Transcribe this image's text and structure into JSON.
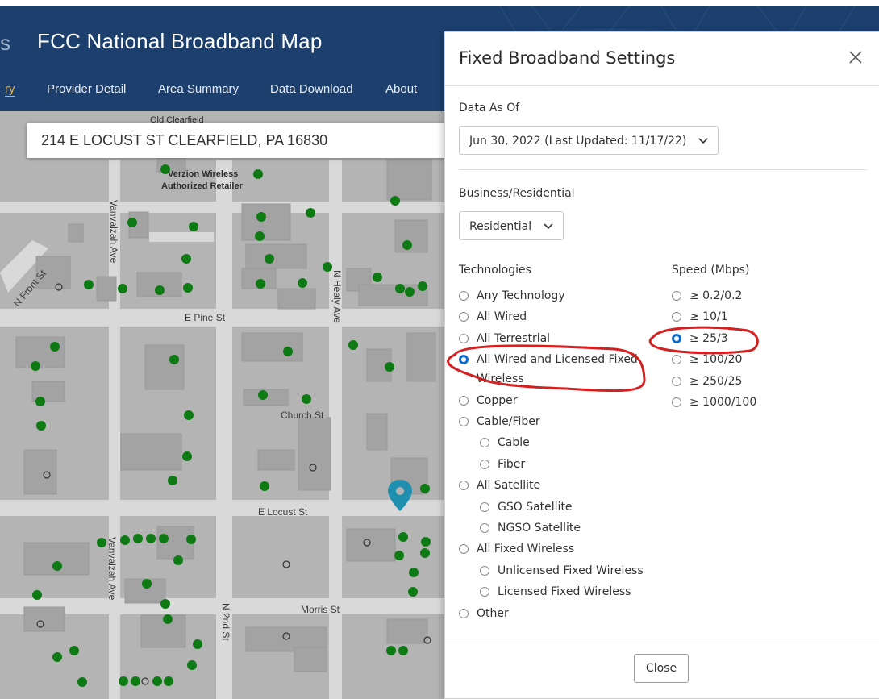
{
  "header": {
    "title": "FCC National Broadband Map",
    "nav": [
      {
        "label": "ry",
        "active": true
      },
      {
        "label": "Provider Detail",
        "active": false
      },
      {
        "label": "Area Summary",
        "active": false
      },
      {
        "label": "Data Download",
        "active": false
      },
      {
        "label": "About",
        "active": false
      }
    ]
  },
  "search": {
    "value": "214 E LOCUST ST CLEARFIELD, PA 16830"
  },
  "map": {
    "labels": {
      "old_clearfield": "Old Clearfield",
      "verizon": "Verzion Wireless",
      "retailer": "Authorized Retailer",
      "vanvalzah_top": "Vanvalzah Ave",
      "vanvalzah_bottom": "Vanvalzah Ave",
      "n_front": "N Front St",
      "n_healy": "N Healy Ave",
      "pine": "E Pine St",
      "church": "Church St",
      "locust": "E Locust St",
      "morris": "Morris St",
      "n_2nd": "N 2nd St"
    },
    "colors": {
      "served": "#0e7a14",
      "unserved_ring": "#333333",
      "pin": "#1f8fb0"
    }
  },
  "modal": {
    "title": "Fixed Broadband Settings",
    "close_icon": "close-icon",
    "data_as_of": {
      "label": "Data As Of",
      "value": "Jun 30, 2022 (Last Updated: 11/17/22)"
    },
    "business_residential": {
      "label": "Business/Residential",
      "value": "Residential"
    },
    "technologies": {
      "label": "Technologies",
      "options": [
        {
          "label": "Any Technology",
          "checked": false
        },
        {
          "label": "All Wired",
          "checked": false
        },
        {
          "label": "All Terrestrial",
          "checked": false
        },
        {
          "label": "All Wired and Licensed Fixed",
          "label2": "Wireless",
          "checked": true
        },
        {
          "label": "Copper",
          "checked": false
        },
        {
          "label": "Cable/Fiber",
          "checked": false
        },
        {
          "label": "Cable",
          "checked": false
        },
        {
          "label": "Fiber",
          "checked": false
        },
        {
          "label": "All Satellite",
          "checked": false
        },
        {
          "label": "GSO Satellite",
          "checked": false
        },
        {
          "label": "NGSO Satellite",
          "checked": false
        },
        {
          "label": "All Fixed Wireless",
          "checked": false
        },
        {
          "label": "Unlicensed Fixed Wireless",
          "checked": false
        },
        {
          "label": "Licensed Fixed Wireless",
          "checked": false
        },
        {
          "label": "Other",
          "checked": false
        }
      ]
    },
    "speed": {
      "label": "Speed (Mbps)",
      "options": [
        {
          "label": "≥ 0.2/0.2",
          "checked": false
        },
        {
          "label": "≥ 10/1",
          "checked": false
        },
        {
          "label": "≥ 25/3",
          "checked": true
        },
        {
          "label": "≥ 100/20",
          "checked": false
        },
        {
          "label": "≥ 250/25",
          "checked": false
        },
        {
          "label": "≥ 1000/100",
          "checked": false
        }
      ]
    },
    "close_button": "Close",
    "annotation_color": "#d42020"
  }
}
